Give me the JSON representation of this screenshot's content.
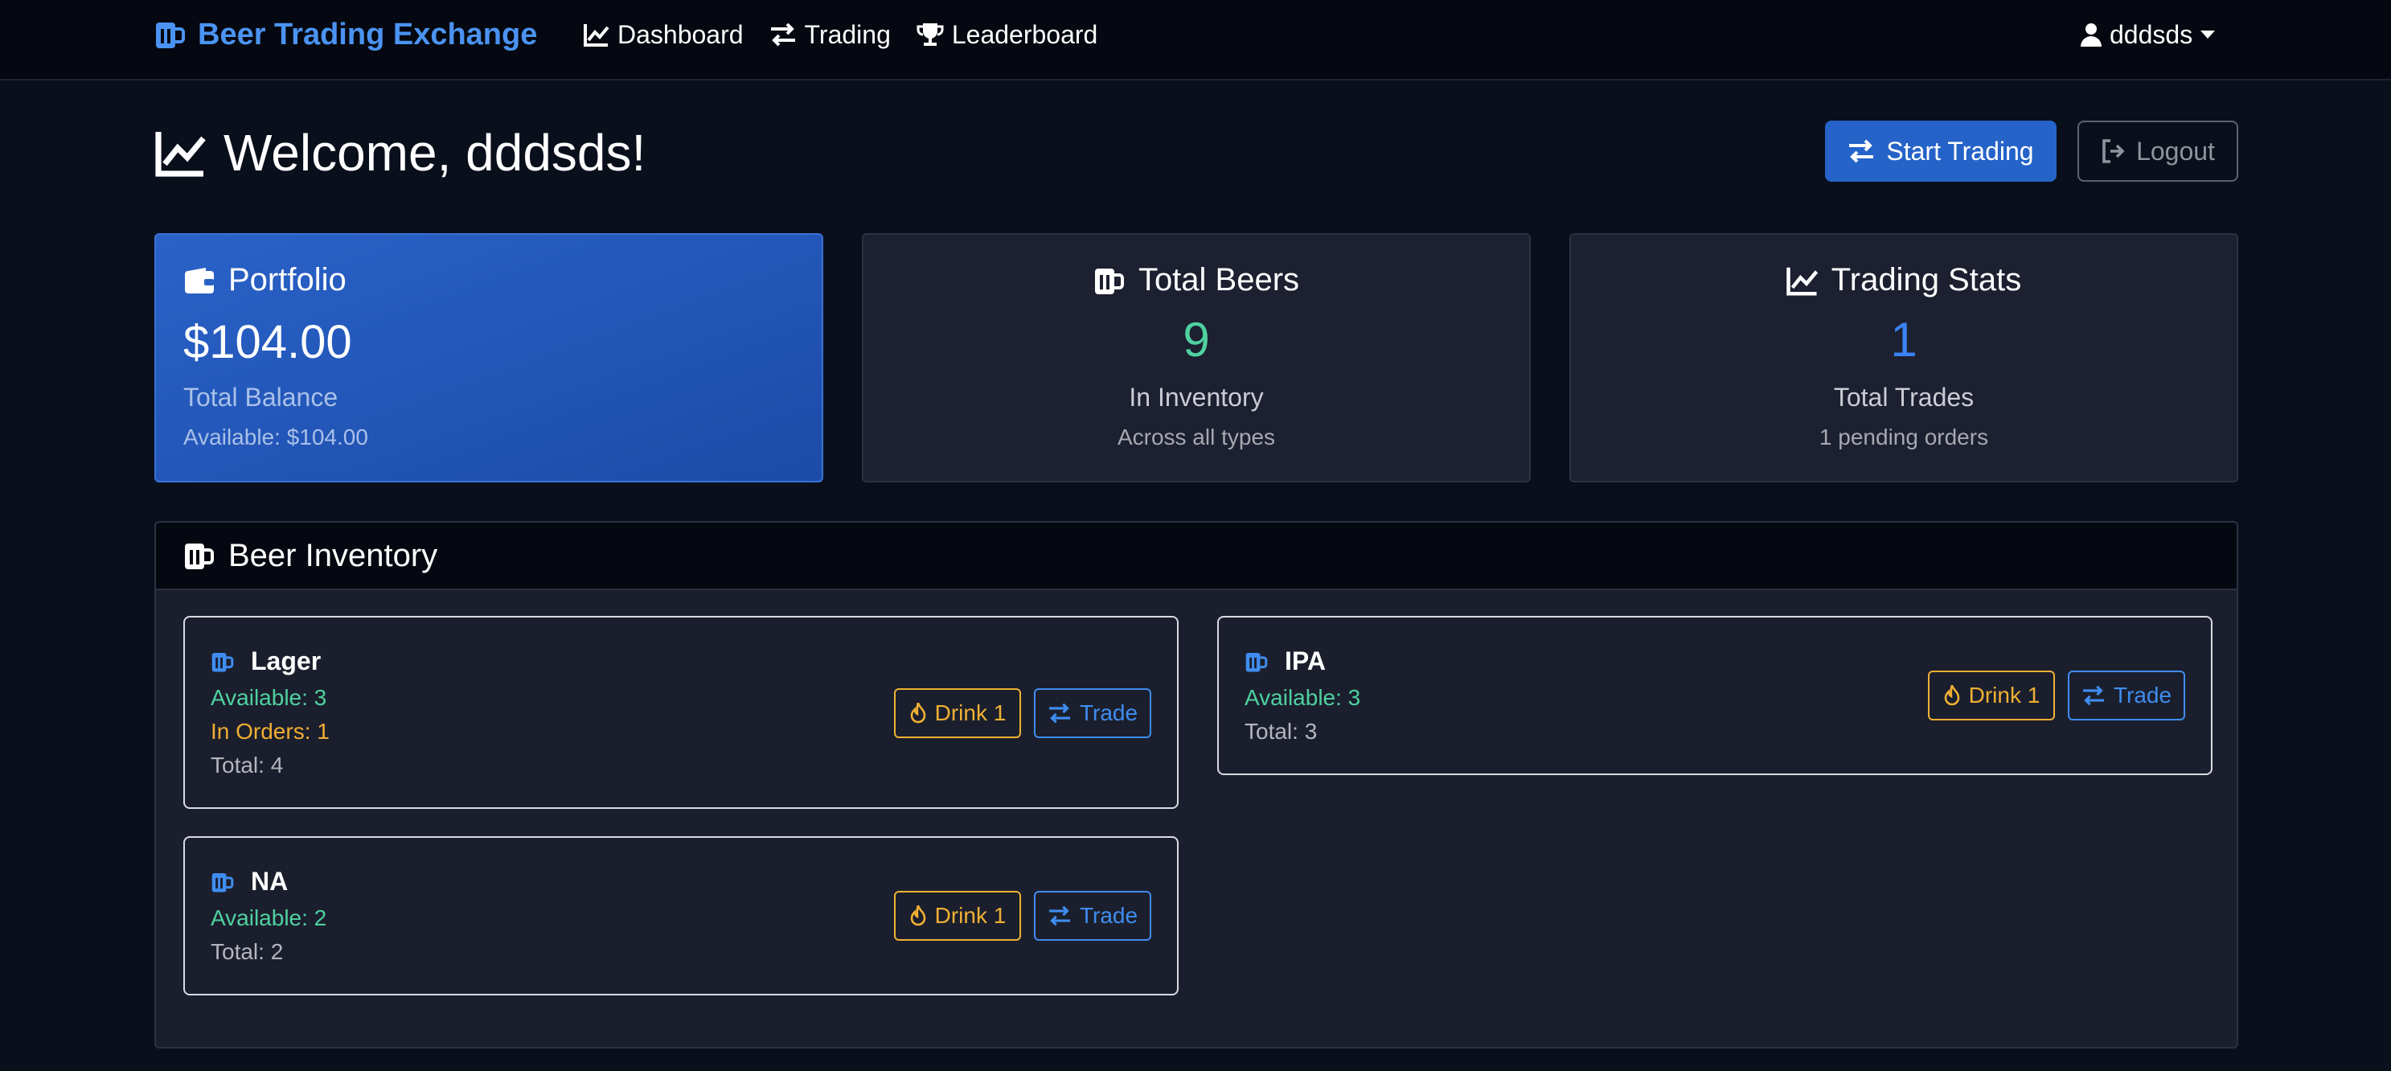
{
  "colors": {
    "brand": "#4b93f2",
    "primary": "#2563c9",
    "success": "#4fd1a0",
    "warning": "#f0ad33",
    "background": "#0a0f1c"
  },
  "navbar": {
    "brand": "Beer Trading Exchange",
    "brand_icon": "beer-mug-icon",
    "links": [
      {
        "label": "Dashboard",
        "icon": "chart-line-icon"
      },
      {
        "label": "Trading",
        "icon": "exchange-arrows-icon"
      },
      {
        "label": "Leaderboard",
        "icon": "trophy-icon"
      }
    ],
    "user": "dddsds"
  },
  "header": {
    "title": "Welcome, dddsds!",
    "start_trading": "Start Trading",
    "logout": "Logout"
  },
  "cards": {
    "portfolio": {
      "title": "Portfolio",
      "value": "$104.00",
      "label": "Total Balance",
      "sub": "Available: $104.00"
    },
    "beers": {
      "title": "Total Beers",
      "value": "9",
      "label": "In Inventory",
      "sub": "Across all types"
    },
    "stats": {
      "title": "Trading Stats",
      "value": "1",
      "label": "Total Trades",
      "sub": "1 pending orders"
    }
  },
  "inventory": {
    "title": "Beer Inventory",
    "items": [
      {
        "name": "Lager",
        "available": "Available: 3",
        "in_orders": "In Orders: 1",
        "total": "Total: 4",
        "drink": "Drink 1",
        "trade": "Trade"
      },
      {
        "name": "IPA",
        "available": "Available: 3",
        "total": "Total: 3",
        "drink": "Drink 1",
        "trade": "Trade"
      },
      {
        "name": "NA",
        "available": "Available: 2",
        "total": "Total: 2",
        "drink": "Drink 1",
        "trade": "Trade"
      }
    ]
  }
}
